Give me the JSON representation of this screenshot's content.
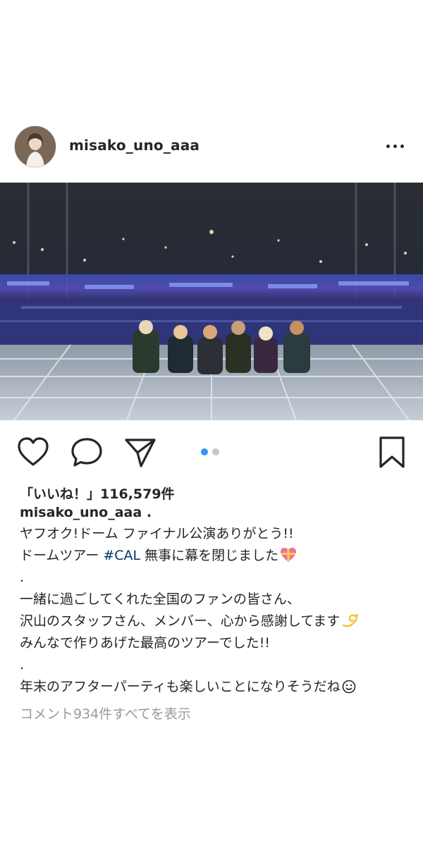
{
  "post": {
    "username": "misako_uno_aaa",
    "more_icon": "more-horizontal-icon",
    "photo_description_icon": "concert-stage-photo",
    "carousel": {
      "count": 2,
      "active": 1
    }
  },
  "actions": {
    "like_icon": "heart-icon",
    "comment_icon": "comment-icon",
    "share_icon": "send-icon",
    "save_icon": "bookmark-icon"
  },
  "likes_text": "「いいね！」116,579件",
  "caption": {
    "username": "misako_uno_aaa",
    "separator": ".",
    "line1": "ヤフオク!ドーム ファイナル公演ありがとう!!",
    "line2_before": "ドームツアー ",
    "line2_hashtag": "#CAL",
    "line2_after": " 無事に幕を閉じました",
    "line3": ".",
    "line4": "一緒に過ごしてくれた全国のファンの皆さん、",
    "line5": "沢山のスタッフさん、メンバー、心から感謝してます",
    "line6": "みんなで作りあげた最高のツアーでした!!",
    "line7": ".",
    "line8": "年末のアフターパーティも楽しいことになりそうだね"
  },
  "comments_link": "コメント934件すべてを表示",
  "colors": {
    "text": "#262626",
    "muted": "#999999",
    "hashtag": "#003569",
    "carousel_active": "#3897f0"
  }
}
